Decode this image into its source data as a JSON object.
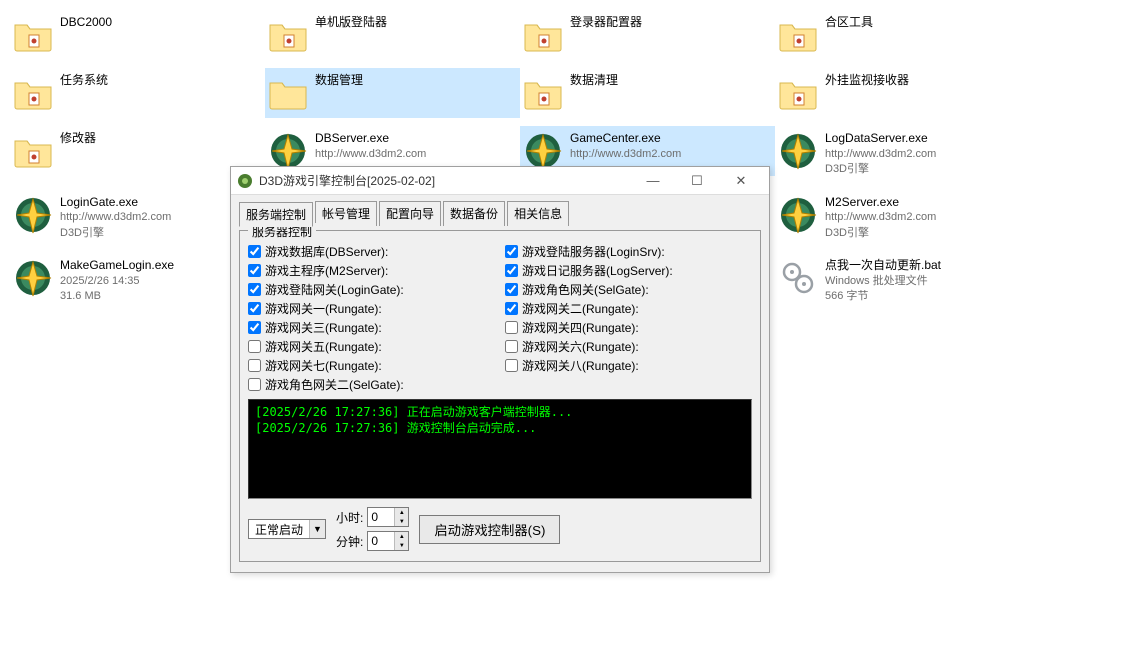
{
  "explorer": {
    "items": [
      {
        "type": "folder",
        "variant": "dot",
        "name": "DBC2000",
        "row": 1,
        "col": 1
      },
      {
        "type": "folder",
        "variant": "dot",
        "name": "单机版登陆器",
        "row": 1,
        "col": 2
      },
      {
        "type": "folder",
        "variant": "dot",
        "name": "登录器配置器",
        "row": 1,
        "col": 3
      },
      {
        "type": "folder",
        "variant": "dot",
        "name": "合区工具",
        "row": 1,
        "col": 4
      },
      {
        "type": "folder",
        "variant": "dot",
        "name": "任务系统",
        "row": 2,
        "col": 1
      },
      {
        "type": "folder",
        "variant": "plain",
        "name": "数据管理",
        "row": 2,
        "col": 2,
        "selected": true
      },
      {
        "type": "folder",
        "variant": "dot",
        "name": "数据清理",
        "row": 2,
        "col": 3
      },
      {
        "type": "folder",
        "variant": "dot",
        "name": "外挂监视接收器",
        "row": 2,
        "col": 4
      },
      {
        "type": "folder",
        "variant": "dot",
        "name": "修改器",
        "row": 3,
        "col": 1
      },
      {
        "type": "exe",
        "name": "DBServer.exe",
        "sub1": "http://www.d3dm2.com",
        "row": 3,
        "col": 2
      },
      {
        "type": "exe",
        "name": "GameCenter.exe",
        "sub1": "http://www.d3dm2.com",
        "row": 3,
        "col": 3,
        "selected": true
      },
      {
        "type": "exe",
        "name": "LogDataServer.exe",
        "sub1": "http://www.d3dm2.com",
        "sub2": "D3D引擎",
        "row": 3,
        "col": 4
      },
      {
        "type": "exe",
        "name": "LoginGate.exe",
        "sub1": "http://www.d3dm2.com",
        "sub2": "D3D引擎",
        "row": 4,
        "col": 1
      },
      {
        "type": "exe",
        "name": "M2Server.exe",
        "sub1": "http://www.d3dm2.com",
        "sub2": "D3D引擎",
        "row": 4,
        "col": 4
      },
      {
        "type": "exe",
        "name": "MakeGameLogin.exe",
        "sub1": "2025/2/26 14:35",
        "sub2": "31.6 MB",
        "row": 5,
        "col": 1
      },
      {
        "type": "bat",
        "name": "点我一次自动更新.bat",
        "sub1": "Windows 批处理文件",
        "sub2": "566 字节",
        "row": 5,
        "col": 4
      }
    ]
  },
  "dialog": {
    "title": "D3D游戏引擎控制台[2025-02-02]",
    "tabs": [
      "服务端控制",
      "帐号管理",
      "配置向导",
      "数据备份",
      "相关信息"
    ],
    "active_tab": 0,
    "group_title": "服务器控制",
    "checks": [
      {
        "label": "游戏数据库(DBServer):",
        "checked": true
      },
      {
        "label": "游戏登陆服务器(LoginSrv):",
        "checked": true
      },
      {
        "label": "游戏主程序(M2Server):",
        "checked": true
      },
      {
        "label": "游戏日记服务器(LogServer):",
        "checked": true
      },
      {
        "label": "游戏登陆网关(LoginGate):",
        "checked": true
      },
      {
        "label": "游戏角色网关(SelGate):",
        "checked": true
      },
      {
        "label": "游戏网关一(Rungate):",
        "checked": true
      },
      {
        "label": "游戏网关二(Rungate):",
        "checked": true
      },
      {
        "label": "游戏网关三(Rungate):",
        "checked": true
      },
      {
        "label": "游戏网关四(Rungate):",
        "checked": false
      },
      {
        "label": "游戏网关五(Rungate):",
        "checked": false
      },
      {
        "label": "游戏网关六(Rungate):",
        "checked": false
      },
      {
        "label": "游戏网关七(Rungate):",
        "checked": false
      },
      {
        "label": "游戏网关八(Rungate):",
        "checked": false
      },
      {
        "label": "游戏角色网关二(SelGate):",
        "checked": false
      }
    ],
    "console": [
      "[2025/2/26 17:27:36] 正在启动游戏客户端控制器...",
      "[2025/2/26 17:27:36] 游戏控制台启动完成..."
    ],
    "combo_value": "正常启动",
    "hour_label": "小时:",
    "hour_value": "0",
    "minute_label": "分钟:",
    "minute_value": "0",
    "start_btn": "启动游戏控制器(S)"
  }
}
